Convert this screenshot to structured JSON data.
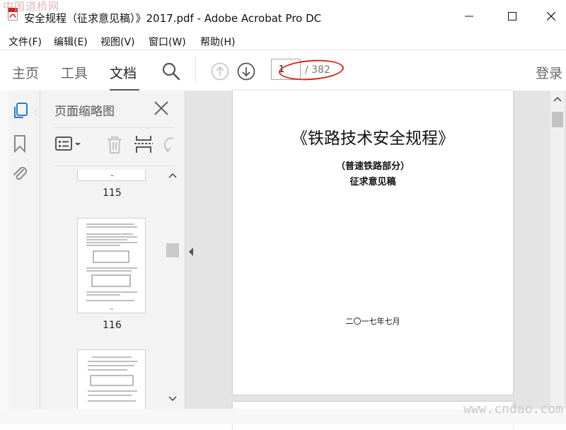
{
  "window": {
    "title": "安全规程（征求意见稿）》2017.pdf - Adobe Acrobat Pro DC"
  },
  "menubar": {
    "items": [
      "文件(F)",
      "编辑(E)",
      "视图(V)",
      "窗口(W)",
      "帮助(H)"
    ]
  },
  "toolbar": {
    "tabs": [
      "主页",
      "工具",
      "文档"
    ],
    "active_tab": "文档",
    "page_current": "1",
    "page_total": "/ 382",
    "login_label": "登录"
  },
  "thumbnails_panel": {
    "title": "页面缩略图",
    "pages": [
      "115",
      "116"
    ]
  },
  "document": {
    "title": "《铁路技术安全规程》",
    "subtitle1": "（普速铁路部分）",
    "subtitle2": "征求意见稿",
    "date": "二〇一七年七月"
  },
  "watermarks": {
    "top_left": "中国道桥网",
    "bottom_right": "www.cndao.com"
  },
  "colors": {
    "accent_blue": "#2a7bd0",
    "annotation_red": "#d42a1d",
    "pdf_red": "#d11f1f"
  }
}
